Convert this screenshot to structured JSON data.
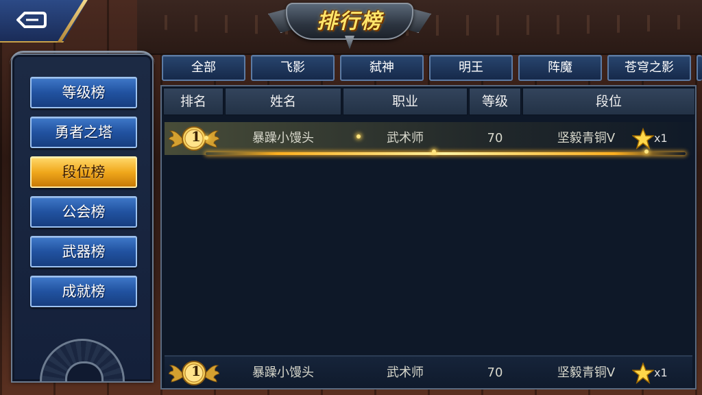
{
  "title": "排行榜",
  "sidebar": {
    "items": [
      {
        "label": "等级榜",
        "active": false
      },
      {
        "label": "勇者之塔",
        "active": false
      },
      {
        "label": "段位榜",
        "active": true
      },
      {
        "label": "公会榜",
        "active": false
      },
      {
        "label": "武器榜",
        "active": false
      },
      {
        "label": "成就榜",
        "active": false
      }
    ]
  },
  "tabs": [
    "全部",
    "飞影",
    "弑神",
    "明王",
    "阵魔",
    "苍穹之影"
  ],
  "columns": [
    "排名",
    "姓名",
    "职业",
    "等级",
    "段位"
  ],
  "rows": [
    {
      "rank": "1",
      "name": "暴躁小馒头",
      "job": "武术师",
      "level": "70",
      "tier": "坚毅青铜V",
      "stars": "x1"
    }
  ],
  "my_rank": {
    "rank": "1",
    "name": "暴躁小馒头",
    "job": "武术师",
    "level": "70",
    "tier": "坚毅青铜V",
    "stars": "x1"
  },
  "colors": {
    "accent_gold": "#f0a81c",
    "button_blue": "#2152a0",
    "panel_bg": "#0e1828"
  }
}
